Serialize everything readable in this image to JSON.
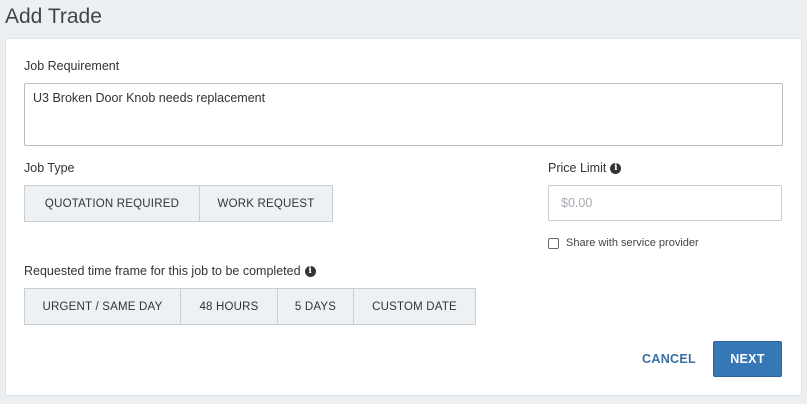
{
  "page": {
    "title": "Add Trade"
  },
  "job_requirement": {
    "label": "Job Requirement",
    "value": "U3 Broken Door Knob needs replacement"
  },
  "job_type": {
    "label": "Job Type",
    "options": [
      "QUOTATION REQUIRED",
      "WORK REQUEST"
    ]
  },
  "price_limit": {
    "label": "Price Limit",
    "placeholder": "$0.00",
    "info_icon": "info-circle-icon",
    "share_label": "Share with service provider",
    "share_checked": false
  },
  "time_frame": {
    "label": "Requested time frame for this job to be completed",
    "info_icon": "info-circle-icon",
    "options": [
      "URGENT / SAME DAY",
      "48 HOURS",
      "5 DAYS",
      "CUSTOM DATE"
    ]
  },
  "actions": {
    "cancel_label": "CANCEL",
    "next_label": "NEXT"
  },
  "colors": {
    "accent": "#3677b6",
    "link": "#3b6ea5",
    "background": "#edf0f3"
  }
}
